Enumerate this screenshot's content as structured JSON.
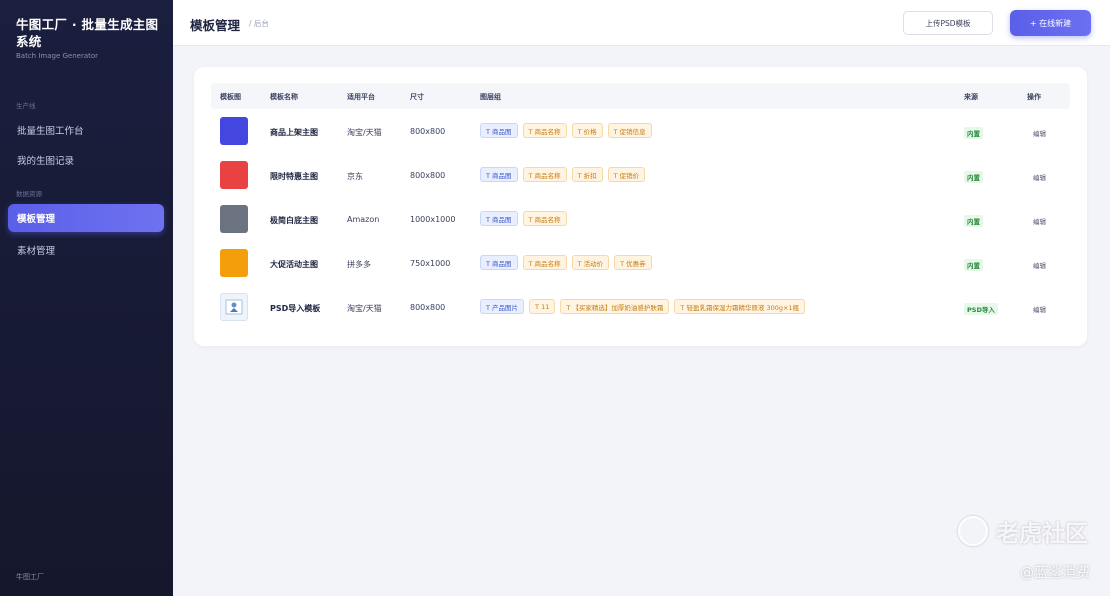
{
  "sidebar": {
    "brand_title": "牛图工厂 · 批量生成主图系统",
    "brand_subtitle": "Batch Image Generator",
    "section1": "生产线",
    "section2": "数据资源",
    "items": [
      {
        "label": "批量生图工作台"
      },
      {
        "label": "我的生图记录"
      },
      {
        "label": "模板管理"
      },
      {
        "label": "素材管理"
      }
    ],
    "footer": "牛图工厂"
  },
  "header": {
    "title": "模板管理",
    "breadcrumb": "/ 后台",
    "upload_label": "上传PSD模板",
    "new_label": "+ 在线新建"
  },
  "table": {
    "headers": [
      "模板图",
      "模板名称",
      "适用平台",
      "尺寸",
      "图层组",
      "来源",
      "操作"
    ],
    "rows": [
      {
        "color": "#4347e0",
        "name": "商品上架主图",
        "platform": "淘宝/天猫",
        "size": "800x800",
        "layers": [
          {
            "text": "T 商品图",
            "kind": "blue"
          },
          {
            "text": "T 商品名称",
            "kind": "orange"
          },
          {
            "text": "T 价格",
            "kind": "orange"
          },
          {
            "text": "T 促销信息",
            "kind": "orange"
          }
        ],
        "source": "内置",
        "action": "编辑"
      },
      {
        "color": "#e84242",
        "name": "限时特惠主图",
        "platform": "京东",
        "size": "800x800",
        "layers": [
          {
            "text": "T 商品图",
            "kind": "blue"
          },
          {
            "text": "T 商品名称",
            "kind": "orange"
          },
          {
            "text": "T 折扣",
            "kind": "orange"
          },
          {
            "text": "T 促销价",
            "kind": "orange"
          }
        ],
        "source": "内置",
        "action": "编辑"
      },
      {
        "color": "#6c7380",
        "name": "极简白底主图",
        "platform": "Amazon",
        "size": "1000x1000",
        "layers": [
          {
            "text": "T 商品图",
            "kind": "blue"
          },
          {
            "text": "T 商品名称",
            "kind": "orange"
          }
        ],
        "source": "内置",
        "action": "编辑"
      },
      {
        "color": "#f59e0b",
        "name": "大促活动主图",
        "platform": "拼多多",
        "size": "750x1000",
        "layers": [
          {
            "text": "T 商品图",
            "kind": "blue"
          },
          {
            "text": "T 商品名称",
            "kind": "orange"
          },
          {
            "text": "T 活动价",
            "kind": "orange"
          },
          {
            "text": "T 优惠券",
            "kind": "orange"
          }
        ],
        "source": "内置",
        "action": "编辑"
      },
      {
        "color": "",
        "name": "PSD导入模板",
        "platform": "淘宝/天猫",
        "size": "800x800",
        "layers": [
          {
            "text": "T 产品图片",
            "kind": "blue"
          },
          {
            "text": "T 11",
            "kind": "orange"
          },
          {
            "text": "T 【买家精选】加厚奶油感护肤霜",
            "kind": "orange"
          },
          {
            "text": "T 轻盈乳霜保湿力霜精华原液 300g×1瓶",
            "kind": "orange"
          }
        ],
        "source": "PSD导入",
        "action": "编辑"
      }
    ]
  },
  "watermark": {
    "primary": "老虎社区",
    "secondary": "@蓝鲨消费"
  }
}
